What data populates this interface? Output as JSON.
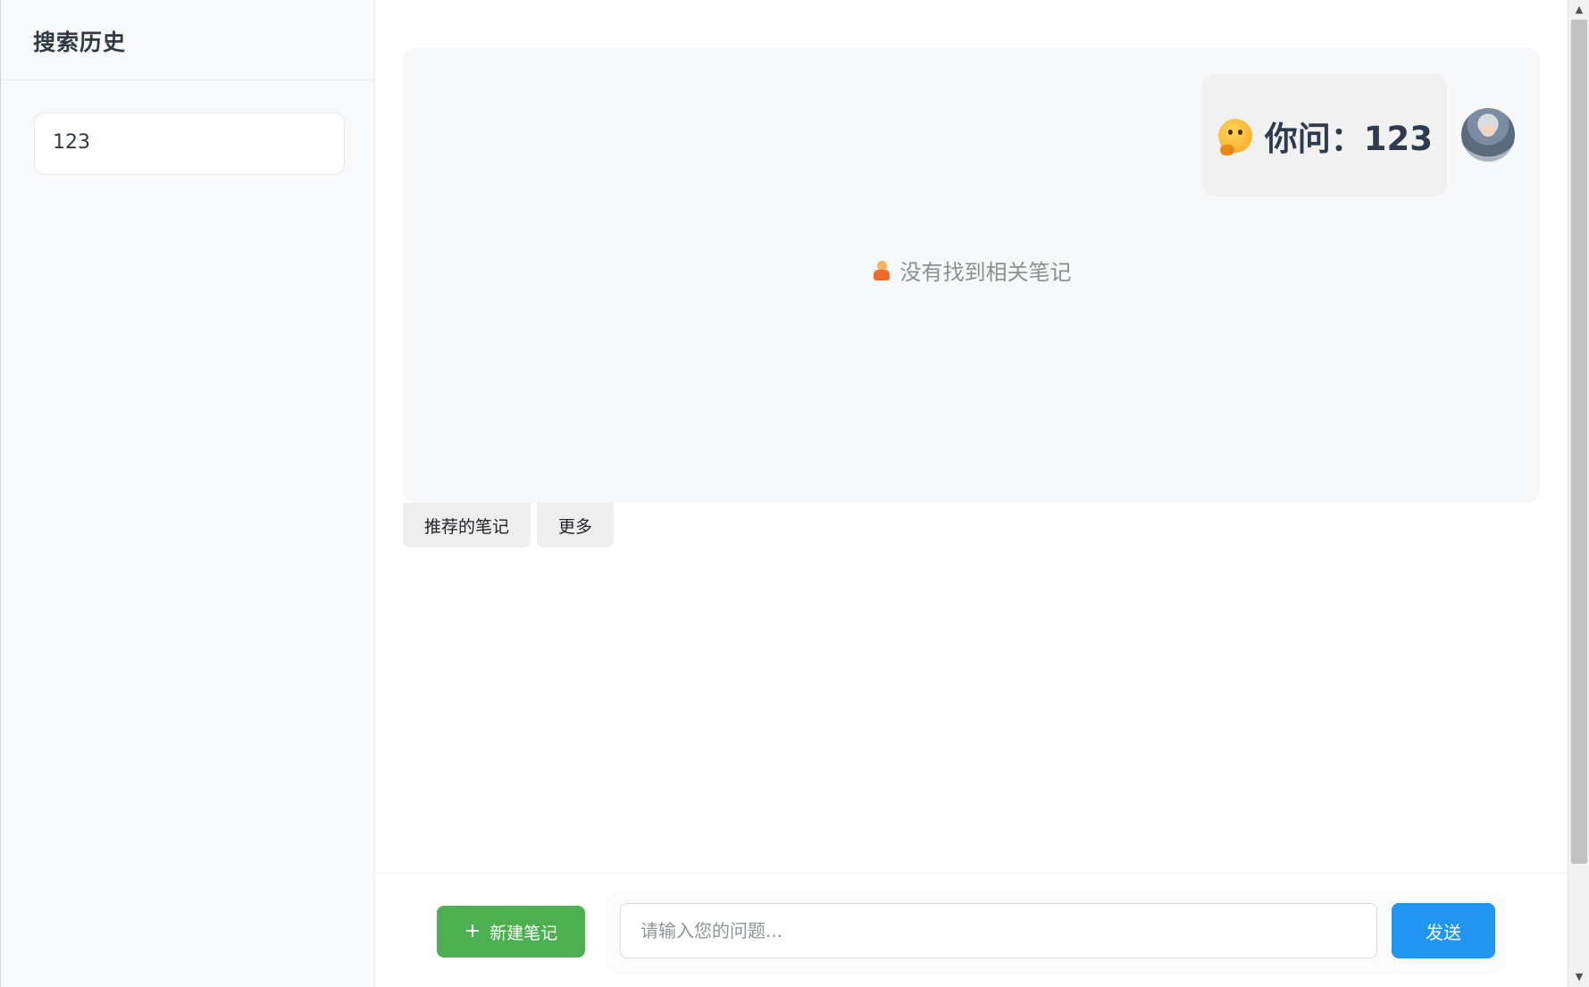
{
  "sidebar": {
    "title": "搜索历史",
    "history_items": [
      "123"
    ]
  },
  "chat": {
    "question_text": "你问：123",
    "question_icon": "thinking-face-icon",
    "avatar": "user-avatar",
    "empty_icon": "shrug-icon",
    "empty_text": "没有找到相关笔记"
  },
  "tabs": {
    "recommended_label": "推荐的笔记",
    "more_label": "更多"
  },
  "bottom_bar": {
    "new_note_icon": "+",
    "new_note_label": "新建笔记",
    "input_placeholder": "请输入您的问题...",
    "input_value": "",
    "send_label": "发送"
  },
  "colors": {
    "new_note_button": "#4caf50",
    "send_button": "#2196f3",
    "sidebar_bg": "#f7f9fb",
    "chat_panel_bg": "#f7f8fa"
  }
}
